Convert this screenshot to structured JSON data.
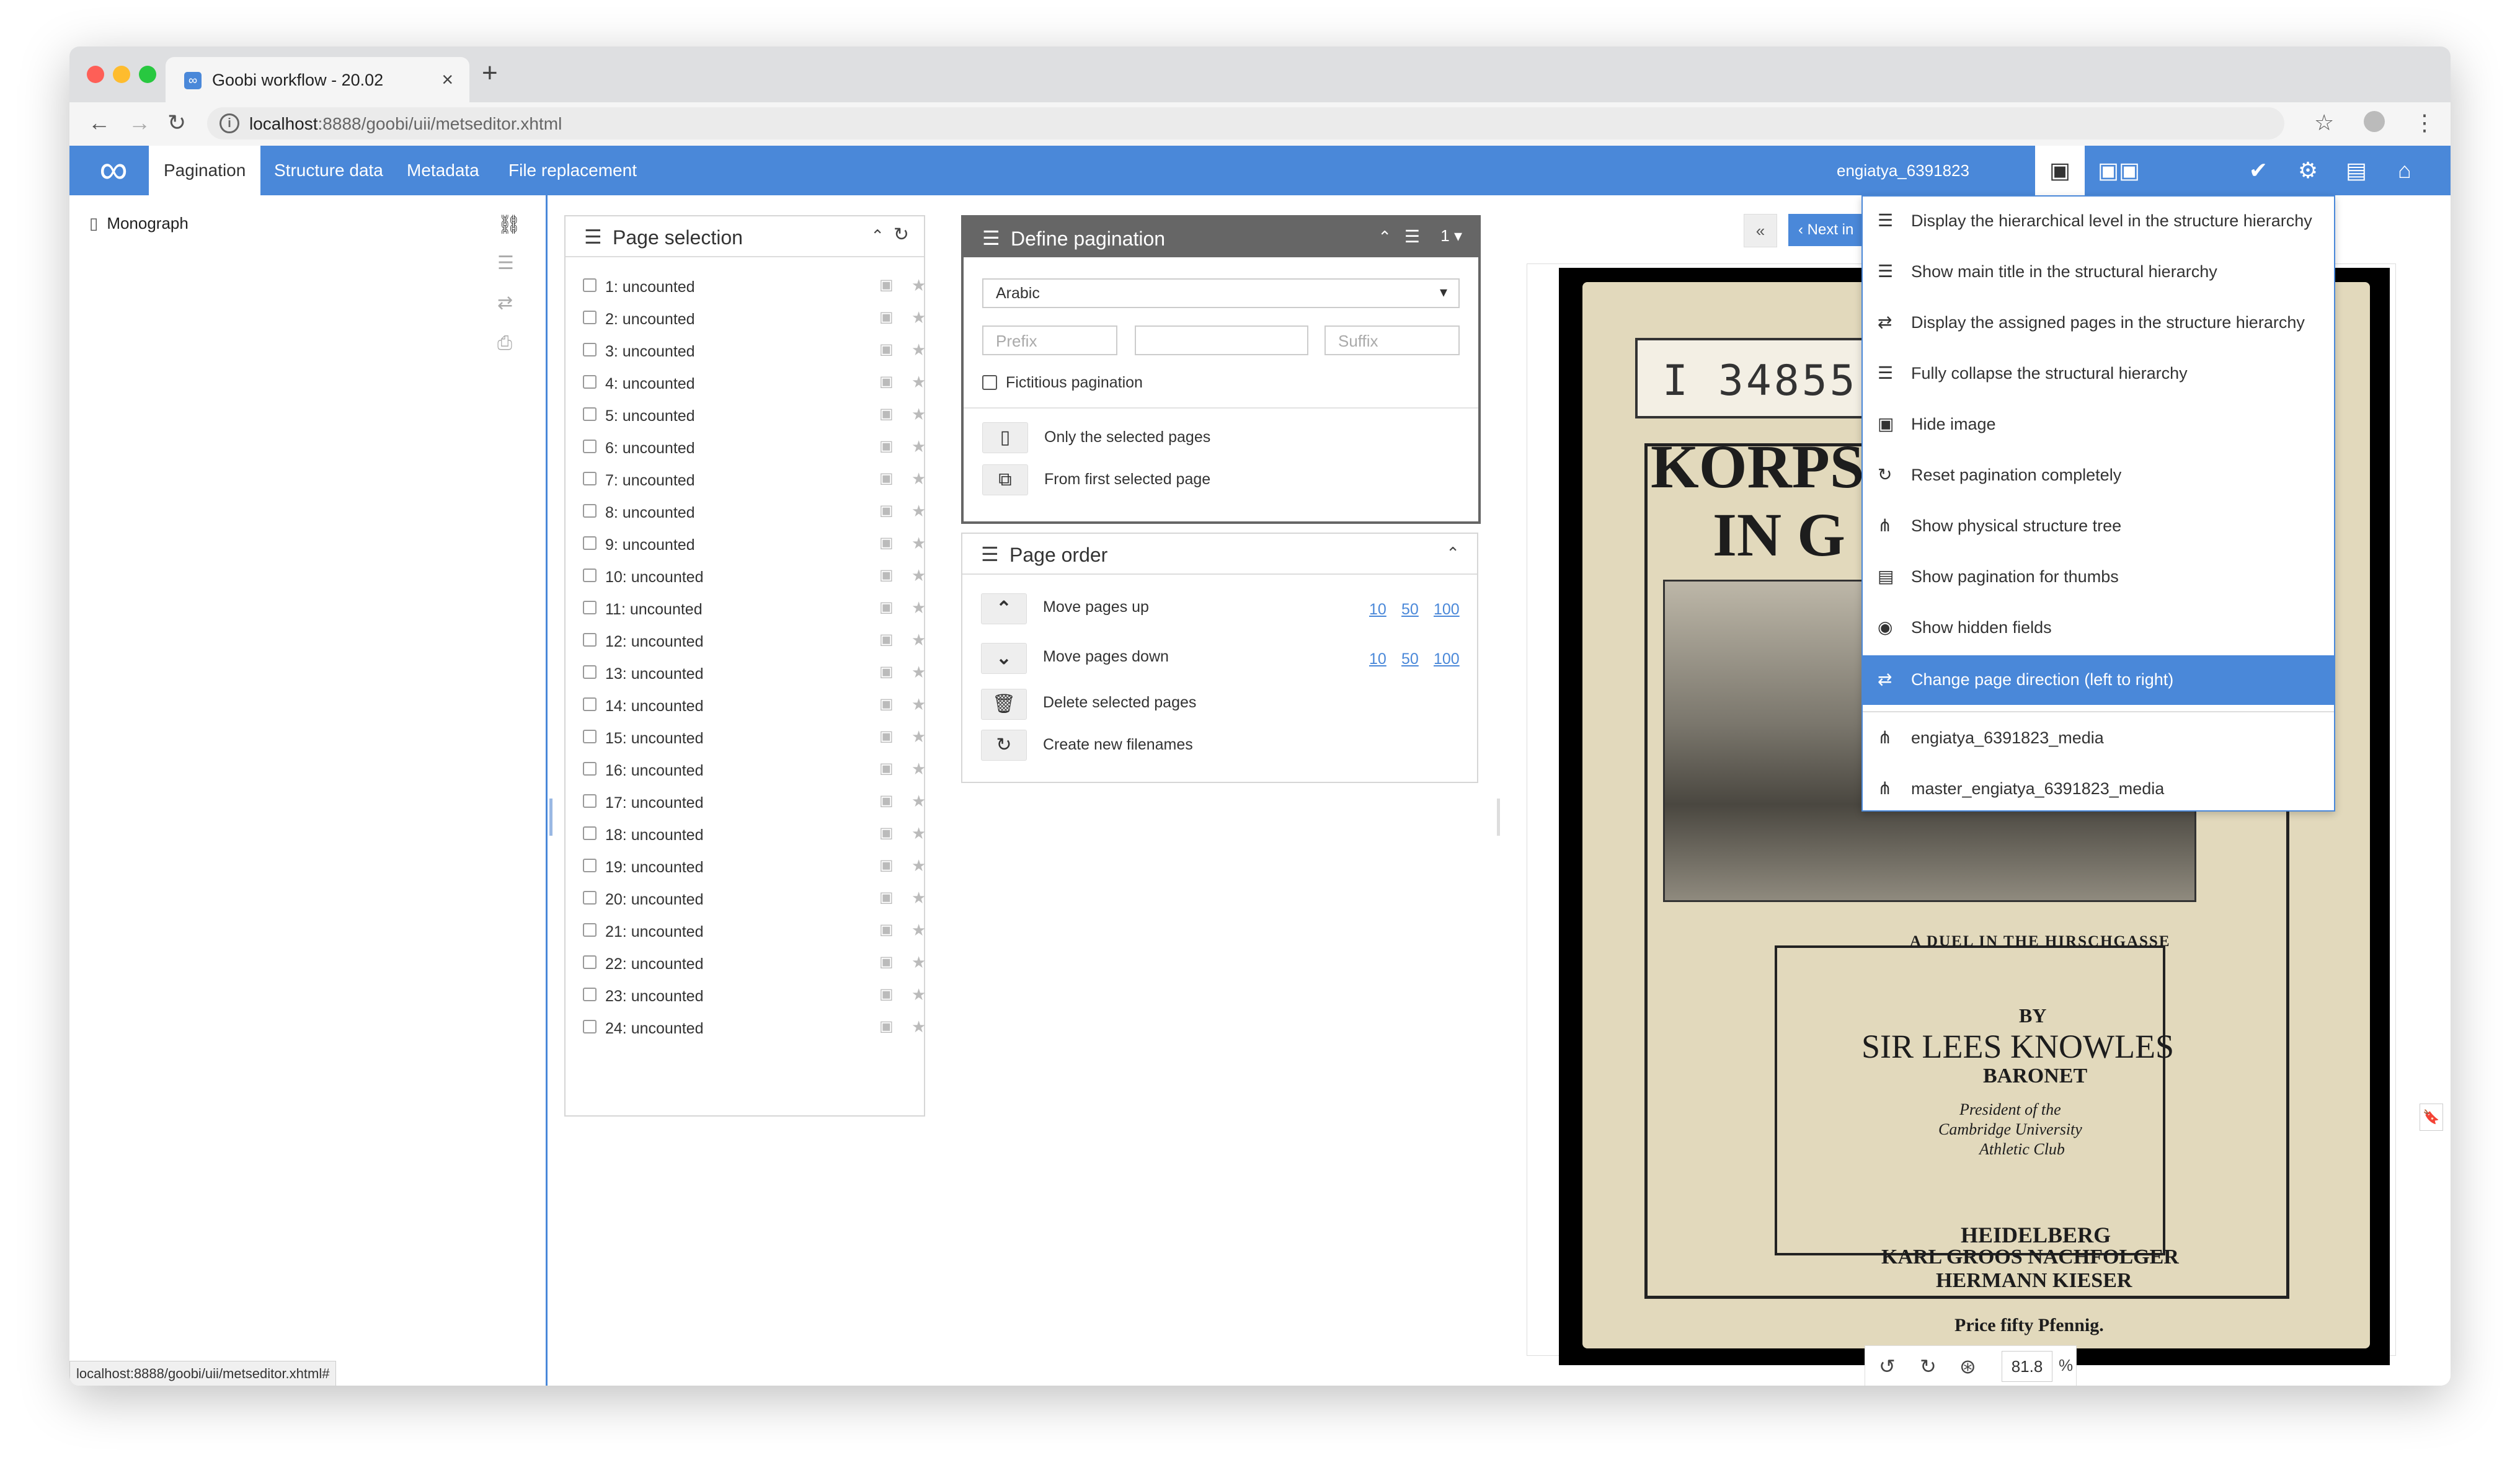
{
  "browser": {
    "tab_title": "Goobi workflow - 20.02",
    "tab_close": "×",
    "new_tab": "+",
    "url_host": "localhost",
    "url_path": ":8888/goobi/uii/metseditor.xhtml",
    "status_url": "localhost:8888/goobi/uii/metseditor.xhtml#",
    "traffic_colors": [
      "#fe5f57",
      "#febc2e",
      "#28c840"
    ]
  },
  "header": {
    "logo": "∞",
    "tabs": [
      {
        "label": "Pagination",
        "active": true
      },
      {
        "label": "Structure data",
        "active": false
      },
      {
        "label": "Metadata",
        "active": false
      },
      {
        "label": "File replacement",
        "active": false
      }
    ],
    "process_name": "engiatya_6391823",
    "accent_color": "#4a88d9"
  },
  "structure": {
    "root_label": "Monograph"
  },
  "page_selection": {
    "title": "Page selection",
    "pages": [
      "1: uncounted",
      "2: uncounted",
      "3: uncounted",
      "4: uncounted",
      "5: uncounted",
      "6: uncounted",
      "7: uncounted",
      "8: uncounted",
      "9: uncounted",
      "10: uncounted",
      "11: uncounted",
      "12: uncounted",
      "13: uncounted",
      "14: uncounted",
      "15: uncounted",
      "16: uncounted",
      "17: uncounted",
      "18: uncounted",
      "19: uncounted",
      "20: uncounted",
      "21: uncounted",
      "22: uncounted",
      "23: uncounted",
      "24: uncounted"
    ]
  },
  "define_pagination": {
    "title": "Define pagination",
    "count_value": "1",
    "type_value": "Arabic",
    "prefix_placeholder": "Prefix",
    "value_placeholder": "",
    "suffix_placeholder": "Suffix",
    "fictitious_label": "Fictitious pagination",
    "only_selected_label": "Only the selected pages",
    "from_first_label": "From first selected page"
  },
  "page_order": {
    "title": "Page order",
    "move_up_label": "Move pages up",
    "move_down_label": "Move pages down",
    "delete_label": "Delete selected pages",
    "filenames_label": "Create new filenames",
    "steps": [
      "10",
      "50",
      "100"
    ]
  },
  "image_view": {
    "prev_label": "«",
    "next_label": "‹ Next in",
    "zoom_value": "81.8",
    "zoom_unit": "%",
    "book": {
      "stamp": "I  34855",
      "title1": "KORPS",
      "title2": "IN G",
      "caption": "A DUEL IN THE HIRSCHGASSE",
      "by": "BY",
      "author": "SIR LEES KNOWLES",
      "rank": "BARONET",
      "role1": "President of the",
      "role2": "Cambridge University",
      "role3": "Athletic Club",
      "place": "HEIDELBERG",
      "publisher1": "KARL GROOS NACHFOLGER",
      "publisher2": "HERMANN KIESER",
      "price": "Price fifty Pfennig."
    }
  },
  "menu": {
    "items": [
      {
        "icon": "list-indent-icon",
        "glyph": "☰",
        "label": "Display the hierarchical level in the structure hierarchy",
        "selected": false
      },
      {
        "icon": "list-icon",
        "glyph": "☰",
        "label": "Show main title in the structural hierarchy",
        "selected": false
      },
      {
        "icon": "exchange-icon",
        "glyph": "⇄",
        "label": "Display the assigned pages in the structure hierarchy",
        "selected": false
      },
      {
        "icon": "collapse-icon",
        "glyph": "☰",
        "label": "Fully collapse the structural hierarchy",
        "selected": false
      },
      {
        "icon": "image-icon",
        "glyph": "▣",
        "label": "Hide image",
        "selected": false
      },
      {
        "icon": "refresh-icon",
        "glyph": "↻",
        "label": "Reset pagination completely",
        "selected": false
      },
      {
        "icon": "sitemap-icon",
        "glyph": "⋔",
        "label": "Show physical structure tree",
        "selected": false
      },
      {
        "icon": "file-icon",
        "glyph": "▤",
        "label": "Show pagination for thumbs",
        "selected": false
      },
      {
        "icon": "eye-icon",
        "glyph": "◉",
        "label": "Show hidden fields",
        "selected": false
      },
      {
        "icon": "exchange-icon",
        "glyph": "⇄",
        "label": "Change page direction (left to right)",
        "selected": true
      },
      {
        "icon": "sitemap-icon",
        "glyph": "⋔",
        "label": "engiatya_6391823_media",
        "selected": false
      },
      {
        "icon": "sitemap-icon",
        "glyph": "⋔",
        "label": "master_engiatya_6391823_media",
        "selected": false
      }
    ]
  }
}
